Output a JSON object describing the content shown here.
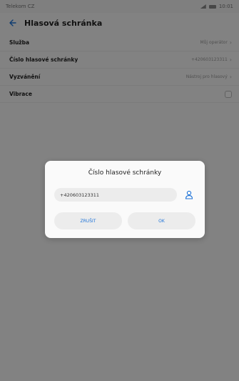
{
  "statusbar": {
    "carrier": "Telekom CZ",
    "time": "10:01"
  },
  "appbar": {
    "title": "Hlasová schránka"
  },
  "settings": [
    {
      "label": "Služba",
      "value": "Můj operátor",
      "type": "link"
    },
    {
      "label": "Číslo hlasové schránky",
      "value": "+420603123311",
      "type": "link"
    },
    {
      "label": "Vyzvánění",
      "value": "Nástroj pro hlasový",
      "type": "link"
    },
    {
      "label": "Vibrace",
      "value": "",
      "type": "checkbox"
    }
  ],
  "dialog": {
    "title": "Číslo hlasové schránky",
    "input_value": "+420603123311",
    "cancel_label": "ZRUŠIT",
    "ok_label": "OK"
  },
  "colors": {
    "accent": "#1e73d8",
    "scrim": "#00000080"
  },
  "icons": {
    "back": "back-arrow-icon",
    "contact": "contact-icon",
    "chevron": "chevron-right-icon"
  }
}
